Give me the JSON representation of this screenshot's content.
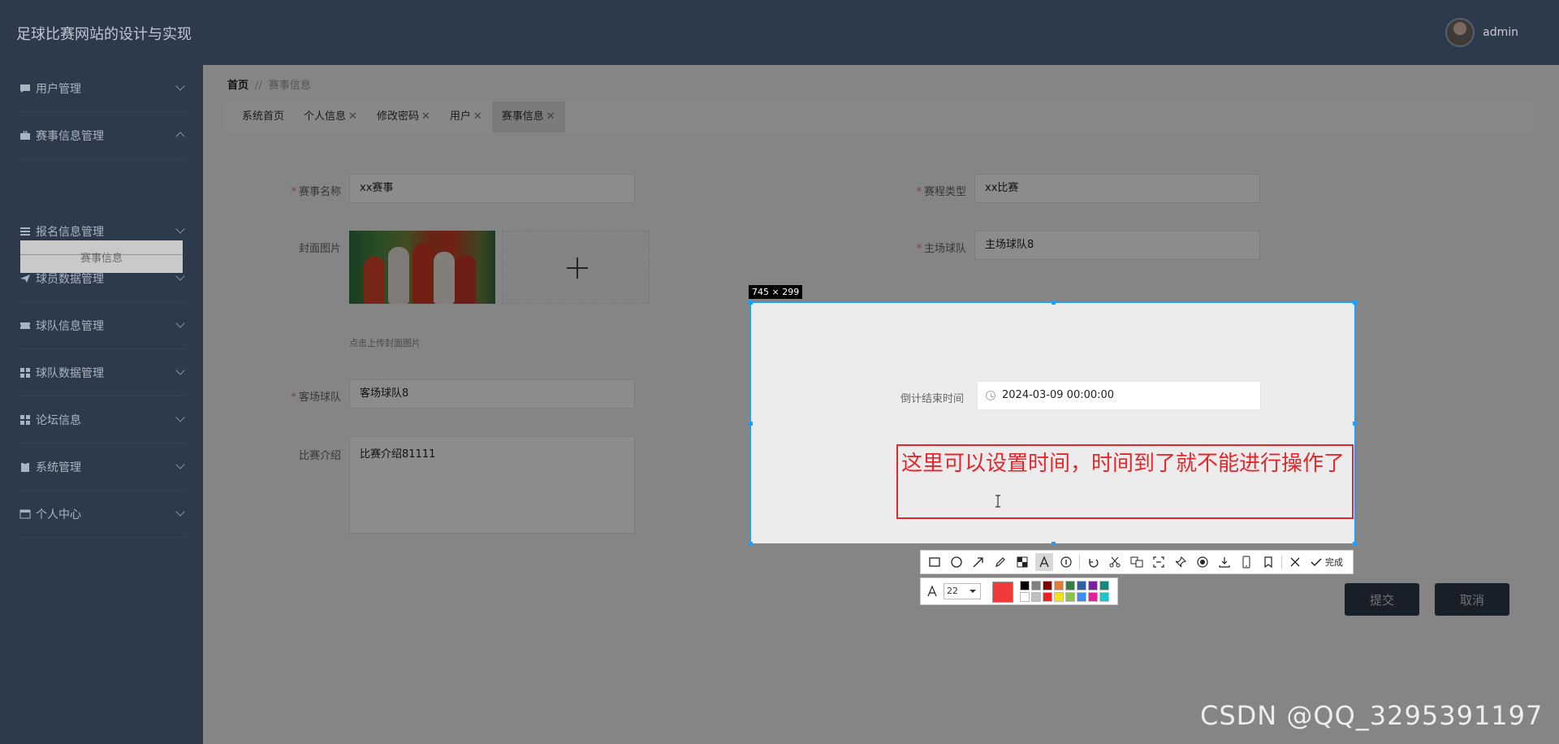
{
  "header": {
    "title": "足球比赛网站的设计与实现",
    "username": "admin"
  },
  "sidebar": {
    "items": [
      {
        "label": "用户管理",
        "icon": "chat-icon",
        "expanded": false
      },
      {
        "label": "赛事信息管理",
        "icon": "briefcase-icon",
        "expanded": true
      },
      {
        "label": "报名信息管理",
        "icon": "list-icon",
        "expanded": false
      },
      {
        "label": "球员数据管理",
        "icon": "send-icon",
        "expanded": false
      },
      {
        "label": "球队信息管理",
        "icon": "ticket-icon",
        "expanded": false
      },
      {
        "label": "球队数据管理",
        "icon": "grid-icon",
        "expanded": false
      },
      {
        "label": "论坛信息",
        "icon": "grid-icon",
        "expanded": false
      },
      {
        "label": "系统管理",
        "icon": "clipboard-icon",
        "expanded": false
      },
      {
        "label": "个人中心",
        "icon": "calendar-icon",
        "expanded": false
      }
    ],
    "active_sub": "赛事信息"
  },
  "breadcrumb": {
    "home": "首页",
    "separator": "//",
    "current": "赛事信息"
  },
  "tabs": [
    {
      "label": "系统首页",
      "closable": false
    },
    {
      "label": "个人信息",
      "closable": true
    },
    {
      "label": "修改密码",
      "closable": true
    },
    {
      "label": "用户",
      "closable": true
    },
    {
      "label": "赛事信息",
      "closable": true
    }
  ],
  "form": {
    "name_label": "赛事名称",
    "name_value": "xx赛事",
    "type_label": "赛程类型",
    "type_value": "xx比赛",
    "cover_label": "封面图片",
    "home_label": "主场球队",
    "home_value": "主场球队8",
    "upload_hint": "点击上传封面图片",
    "away_label": "客场球队",
    "away_value": "客场球队8",
    "intro_label": "比赛介绍",
    "intro_value": "比赛介绍81111",
    "submit": "提交",
    "cancel": "取消"
  },
  "capture": {
    "size_label": "745 × 299",
    "countdown_label": "倒计结束时间",
    "countdown_value": "2024-03-09 00:00:00",
    "annotation": "这里可以设置时间，时间到了就不能进行操作了",
    "done_label": "完成",
    "font_size": "22",
    "current_color": "#f03a3a",
    "palette": [
      "#000000",
      "#808080",
      "#800000",
      "#e07b39",
      "#3a7d44",
      "#2e5fa8",
      "#7a1fa2",
      "#16877a",
      "#ffffff",
      "#c0c0c0",
      "#f02020",
      "#f7e31c",
      "#8bc34a",
      "#3c8df0",
      "#e91e9a",
      "#20c4cf"
    ]
  },
  "watermark": "CSDN @QQ_3295391197"
}
